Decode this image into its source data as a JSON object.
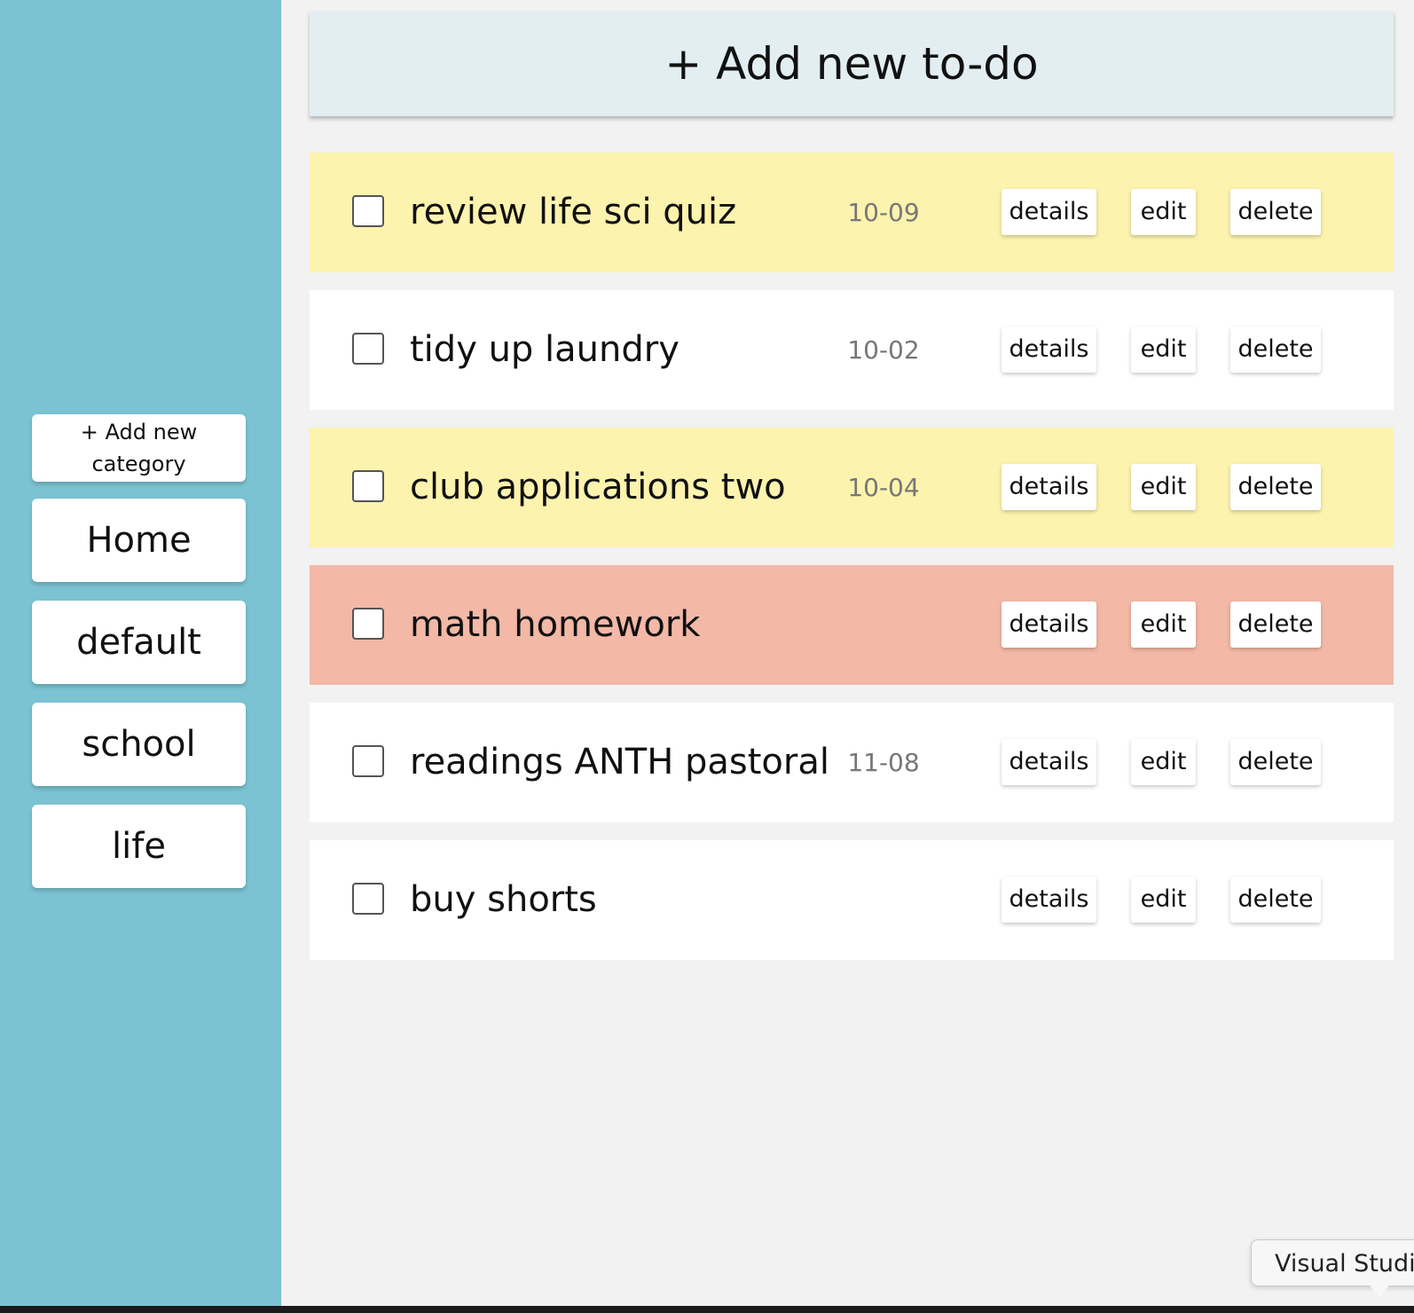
{
  "sidebar": {
    "add_category_label": "+ Add new category",
    "categories": [
      "Home",
      "default",
      "school",
      "life"
    ]
  },
  "main": {
    "add_todo_label": "+ Add new to-do",
    "todos": [
      {
        "title": "review life sci quiz",
        "date": "10-09",
        "color": "#fcf3ae",
        "details": "details",
        "edit": "edit",
        "delete": "delete"
      },
      {
        "title": "tidy up laundry",
        "date": "10-02",
        "color": "#ffffff",
        "details": "details",
        "edit": "edit",
        "delete": "delete"
      },
      {
        "title": "club applications two",
        "date": "10-04",
        "color": "#fcf3ae",
        "details": "details",
        "edit": "edit",
        "delete": "delete"
      },
      {
        "title": "math homework",
        "date": "",
        "color": "#f3b8a6",
        "details": "details",
        "edit": "edit",
        "delete": "delete"
      },
      {
        "title": "readings ANTH pastoral",
        "date": "11-08",
        "color": "#ffffff",
        "details": "details",
        "edit": "edit",
        "delete": "delete"
      },
      {
        "title": "buy shorts",
        "date": "",
        "color": "#ffffff",
        "details": "details",
        "edit": "edit",
        "delete": "delete"
      }
    ]
  },
  "tooltip": {
    "label": "Visual Studio"
  },
  "colors": {
    "sidebar": "#7bc2d2",
    "priority_medium": "#fcf3ae",
    "priority_high": "#f3b8a6",
    "add_todo_bg": "#e3eef2"
  }
}
